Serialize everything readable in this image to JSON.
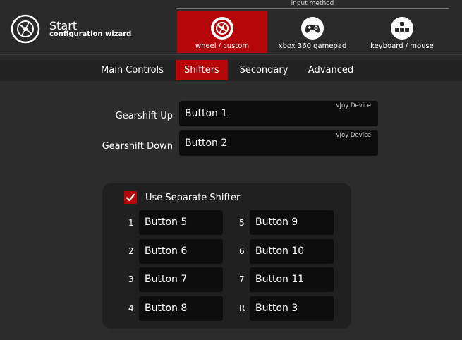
{
  "header": {
    "title": "Start",
    "subtitle": "configuration wizard",
    "method_label": "input method",
    "methods": [
      {
        "label": "wheel / custom",
        "icon": "steering-wheel-icon",
        "selected": true
      },
      {
        "label": "xbox 360 gamepad",
        "icon": "gamepad-icon",
        "selected": false
      },
      {
        "label": "keyboard / mouse",
        "icon": "keyboard-keys-icon",
        "selected": false
      }
    ]
  },
  "tabs": [
    {
      "label": "Main Controls",
      "selected": false
    },
    {
      "label": "Shifters",
      "selected": true
    },
    {
      "label": "Secondary",
      "selected": false
    },
    {
      "label": "Advanced",
      "selected": false
    }
  ],
  "gearshift": [
    {
      "label": "Gearshift Up",
      "value": "Button 1",
      "device": "vJoy Device"
    },
    {
      "label": "Gearshift Down",
      "value": "Button 2",
      "device": "vJoy Device"
    }
  ],
  "shifter": {
    "use_separate_label": "Use Separate Shifter",
    "checked": true,
    "gears": [
      {
        "gear": "1",
        "value": "Button 5"
      },
      {
        "gear": "2",
        "value": "Button 6"
      },
      {
        "gear": "3",
        "value": "Button 7"
      },
      {
        "gear": "4",
        "value": "Button 8"
      },
      {
        "gear": "5",
        "value": "Button 9"
      },
      {
        "gear": "6",
        "value": "Button 10"
      },
      {
        "gear": "7",
        "value": "Button 11"
      },
      {
        "gear": "R",
        "value": "Button 3"
      }
    ]
  },
  "colors": {
    "accent": "#b5070a",
    "field_bg": "#0d0d0d",
    "panel_bg": "#202020",
    "page_bg": "#2c2c2c"
  }
}
